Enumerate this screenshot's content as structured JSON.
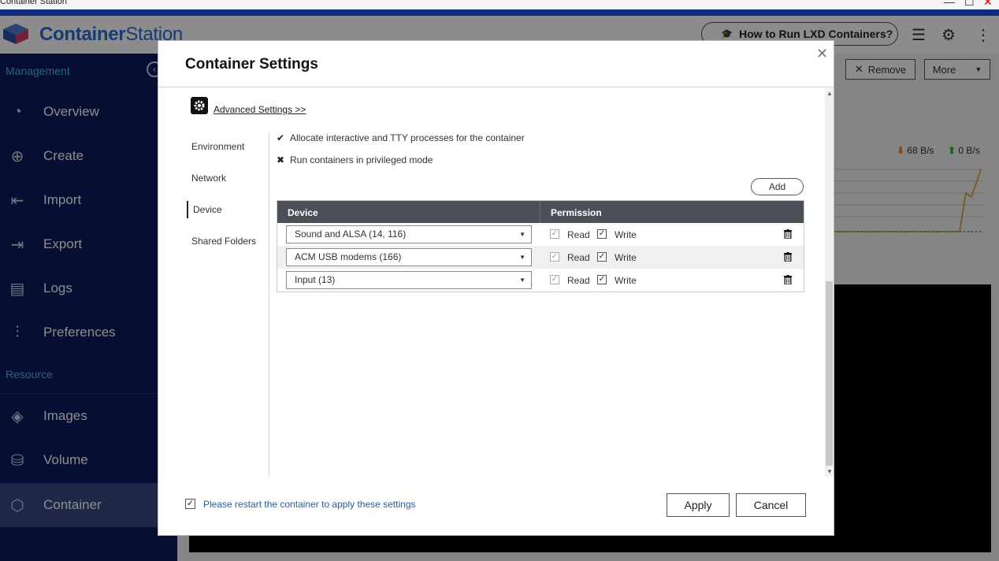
{
  "window": {
    "title": "Container Station",
    "minimize": "—",
    "maximize": "☐",
    "close": "✕"
  },
  "app": {
    "brand_bold": "Container",
    "brand_light": "Station",
    "howto_label": "How to Run LXD Containers?",
    "sidebar": {
      "management_label": "Management",
      "resource_label": "Resource",
      "items": [
        {
          "label": "Overview",
          "icon": "gauge-icon"
        },
        {
          "label": "Create",
          "icon": "plus-icon"
        },
        {
          "label": "Import",
          "icon": "import-icon"
        },
        {
          "label": "Export",
          "icon": "export-icon"
        },
        {
          "label": "Logs",
          "icon": "logs-icon"
        },
        {
          "label": "Preferences",
          "icon": "sliders-icon"
        },
        {
          "label": "Images",
          "icon": "layers-icon"
        },
        {
          "label": "Volume",
          "icon": "cylinder-icon"
        },
        {
          "label": "Container",
          "icon": "cube-icon"
        }
      ]
    },
    "toolbar": {
      "remove_label": "Remove",
      "more_label": "More"
    },
    "network": {
      "download": "68 B/s",
      "upload": "0 B/s"
    }
  },
  "modal": {
    "title": "Container Settings",
    "advanced_link": "Advanced Settings >>",
    "nav": {
      "items": [
        "Environment",
        "Network",
        "Device",
        "Shared Folders"
      ],
      "active": "Device"
    },
    "options": [
      {
        "icon": "check-icon",
        "text": "Allocate interactive and TTY processes for the container"
      },
      {
        "icon": "cross-icon",
        "text": "Run containers in privileged mode"
      }
    ],
    "add_label": "Add",
    "table": {
      "headers": {
        "device": "Device",
        "permission": "Permission"
      },
      "rows": [
        {
          "device": "Sound and ALSA (14, 116)",
          "read_label": "Read",
          "write_label": "Write",
          "read": true,
          "write": true
        },
        {
          "device": "ACM USB modems (166)",
          "read_label": "Read",
          "write_label": "Write",
          "read": true,
          "write": true
        },
        {
          "device": "Input (13)",
          "read_label": "Read",
          "write_label": "Write",
          "read": true,
          "write": true
        }
      ]
    },
    "restart_note": "Please restart the container to apply these settings",
    "apply_label": "Apply",
    "cancel_label": "Cancel"
  },
  "colors": {
    "sidebar_bg": "#0c1c5e",
    "section_label": "#4fb3e3",
    "table_header": "#4a4f58",
    "download_arrow": "#e0901a",
    "upload_arrow": "#3aa83a",
    "link_blue": "#2a5c9c"
  }
}
